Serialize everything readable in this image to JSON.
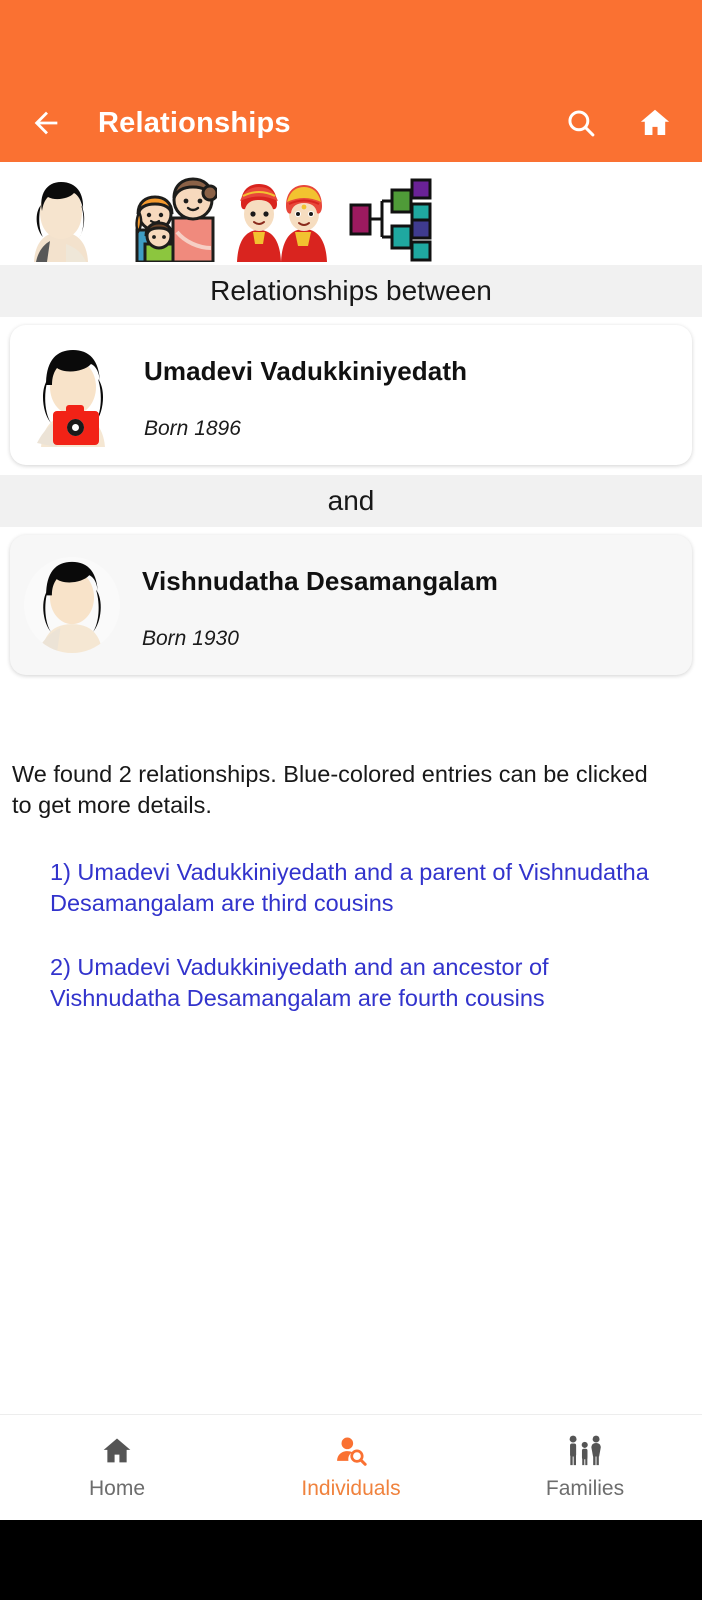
{
  "theme": {
    "accent": "#fa7132",
    "link_blue": "#3233cc",
    "band_bg": "#f1f1f1",
    "nav_inactive": "#6d6d6d",
    "nav_active": "#f0823d",
    "camera_badge_red": "#f22216"
  },
  "appbar": {
    "title": "Relationships",
    "back_icon": "arrow-left-icon",
    "search_icon": "search-icon",
    "home_icon": "home-icon"
  },
  "icon_strip": [
    {
      "name": "individual-avatar-icon",
      "label": "Individual"
    },
    {
      "name": "family-icon",
      "label": "Family"
    },
    {
      "name": "wedding-couple-icon",
      "label": "Couple"
    },
    {
      "name": "family-tree-icon",
      "label": "Family tree"
    }
  ],
  "sections": {
    "between_label": "Relationships between",
    "and_label": "and"
  },
  "people": [
    {
      "name": "Umadevi Vadukkiniyedath",
      "born": "Born 1896",
      "avatar_icon": "person-silhouette-avatar",
      "has_camera_badge": true
    },
    {
      "name": "Vishnudatha Desamangalam",
      "born": "Born 1930",
      "avatar_icon": "person-silhouette-avatar",
      "has_camera_badge": false
    }
  ],
  "results": {
    "summary": "We found 2 relationships. Blue-colored entries can be clicked to get more details.",
    "relationships": [
      "1) Umadevi Vadukkiniyedath and a parent of  Vishnudatha Desamangalam are third cousins",
      "2) Umadevi Vadukkiniyedath and an ancestor of Vishnudatha Desamangalam are fourth cousins"
    ]
  },
  "bottom_nav": {
    "items": [
      {
        "label": "Home",
        "icon": "home-icon",
        "active": false
      },
      {
        "label": "Individuals",
        "icon": "person-search-icon",
        "active": true
      },
      {
        "label": "Families",
        "icon": "family-group-icon",
        "active": false
      }
    ]
  }
}
